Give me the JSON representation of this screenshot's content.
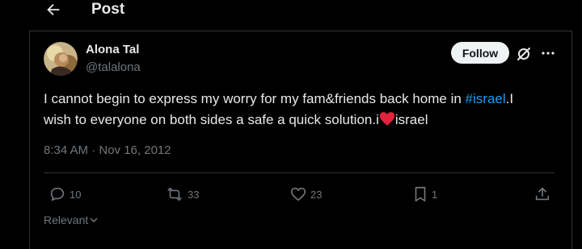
{
  "header": {
    "back_icon": "arrow-left-icon",
    "title": "Post"
  },
  "author": {
    "name": "Alona Tal",
    "handle": "@talalona",
    "follow_label": "Follow",
    "grok_icon": "grok-icon",
    "more_icon": "more-icon"
  },
  "tweet": {
    "text_before": "I cannot begin to express my worry for my fam&friends back home in ",
    "hashtag": "#israel",
    "text_middle": ".I wish to everyone on both sides a safe a quick solution.i",
    "heart_icon": "red-heart-emoji-icon",
    "text_after": "israel",
    "timestamp": "8:34 AM · Nov 16, 2012"
  },
  "actions": {
    "replies": "10",
    "reposts": "33",
    "likes": "23",
    "bookmarks": "1"
  },
  "sort": {
    "label": "Relevant"
  },
  "colors": {
    "background": "#000000",
    "text": "#e7e9ea",
    "muted": "#71767b",
    "accent": "#1d9bf0",
    "heart": "#f91880",
    "border": "#2f3336"
  }
}
